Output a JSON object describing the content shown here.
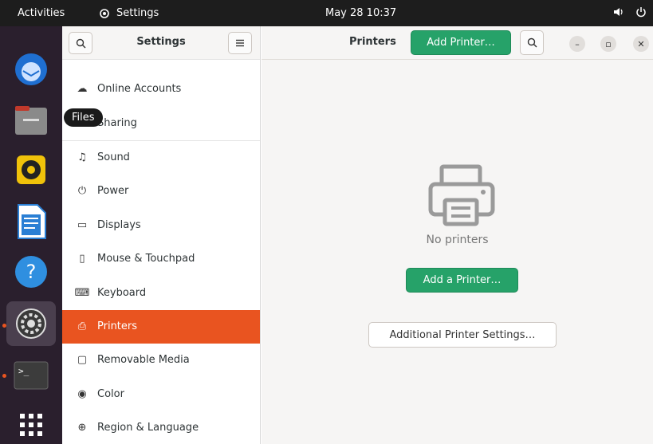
{
  "topbar": {
    "activities": "Activities",
    "app_name": "Settings",
    "clock": "May 28  10:37"
  },
  "dock": {
    "tooltip": "Files",
    "items": [
      "thunderbird",
      "files",
      "rhythmbox",
      "libreoffice-writer",
      "help",
      "settings",
      "terminal",
      "show-applications"
    ]
  },
  "sidebar": {
    "title": "Settings",
    "items": [
      {
        "label": "Online Accounts",
        "icon": "cloud-icon"
      },
      {
        "label": "Sharing",
        "icon": "share-icon"
      },
      {
        "label": "Sound",
        "icon": "music-note-icon"
      },
      {
        "label": "Power",
        "icon": "power-icon"
      },
      {
        "label": "Displays",
        "icon": "display-icon"
      },
      {
        "label": "Mouse & Touchpad",
        "icon": "mouse-icon"
      },
      {
        "label": "Keyboard",
        "icon": "keyboard-icon"
      },
      {
        "label": "Printers",
        "icon": "printer-icon",
        "selected": true
      },
      {
        "label": "Removable Media",
        "icon": "media-icon"
      },
      {
        "label": "Color",
        "icon": "color-icon"
      },
      {
        "label": "Region & Language",
        "icon": "globe-icon"
      }
    ]
  },
  "main": {
    "title": "Printers",
    "add_printer": "Add Printer…",
    "empty_label": "No printers",
    "add_a_printer": "Add a Printer…",
    "additional_settings": "Additional Printer Settings…"
  },
  "colors": {
    "accent": "#e95420",
    "green": "#26a269",
    "dock": "#2a1f2d",
    "topbar": "#1d1d1d"
  }
}
